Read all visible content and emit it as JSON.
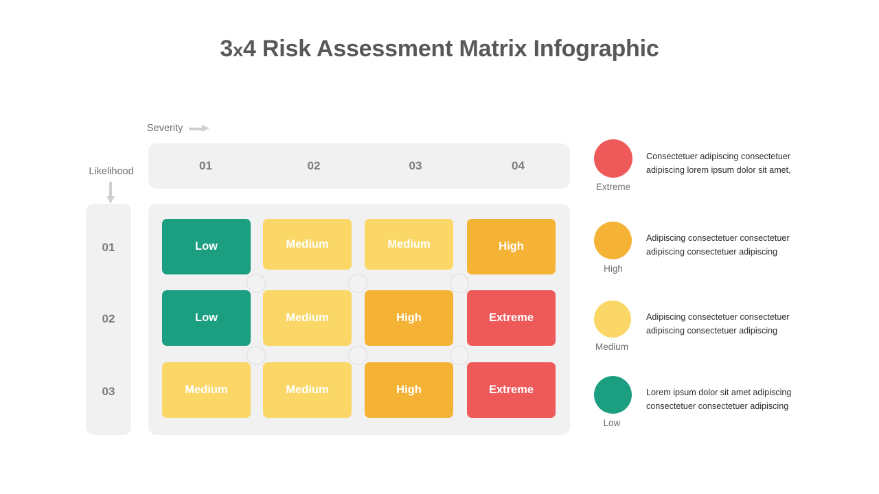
{
  "title": {
    "before": "3",
    "x": "x",
    "after": "4 Risk Assessment Matrix Infographic",
    "full": "3x4 Risk Assessment Matrix Infographic"
  },
  "axes": {
    "severity_label": "Severity",
    "severity_arrow": "arrow-right-icon",
    "likelihood_label": "Likelihood",
    "likelihood_arrow": "arrow-down-icon"
  },
  "colors": {
    "low": "#1C9E81",
    "medium": "#FAD766",
    "high": "#F5B336",
    "extreme": "#EE5A5A",
    "panel_bg": "#F1F1F1",
    "label_gray": "#7B7B7D",
    "title_gray": "#58585A",
    "node": "#F2F2F2"
  },
  "columns": [
    {
      "label": "01"
    },
    {
      "label": "02"
    },
    {
      "label": "03"
    },
    {
      "label": "04"
    }
  ],
  "rows": [
    {
      "label": "01"
    },
    {
      "label": "02"
    },
    {
      "label": "03"
    }
  ],
  "chart_data": {
    "type": "heatmap",
    "title": "3x4 Risk Assessment Matrix Infographic",
    "xlabel": "Severity",
    "ylabel": "Likelihood",
    "x_categories": [
      "01",
      "02",
      "03",
      "04"
    ],
    "y_categories": [
      "01",
      "02",
      "03"
    ],
    "levels": [
      {
        "name": "Low",
        "color": "#1C9E81",
        "value": 1
      },
      {
        "name": "Medium",
        "color": "#FAD766",
        "value": 2
      },
      {
        "name": "High",
        "color": "#F5B336",
        "value": 3
      },
      {
        "name": "Extreme",
        "color": "#EE5A5A",
        "value": 4
      }
    ],
    "cells": [
      [
        {
          "label": "Low",
          "level": "low",
          "value": 1
        },
        {
          "label": "Medium",
          "level": "medium",
          "value": 2
        },
        {
          "label": "Medium",
          "level": "medium",
          "value": 2
        },
        {
          "label": "High",
          "level": "high",
          "value": 3
        }
      ],
      [
        {
          "label": "Low",
          "level": "low",
          "value": 1
        },
        {
          "label": "Medium",
          "level": "medium",
          "value": 2
        },
        {
          "label": "High",
          "level": "high",
          "value": 3
        },
        {
          "label": "Extreme",
          "level": "extreme",
          "value": 4
        }
      ],
      [
        {
          "label": "Medium",
          "level": "medium",
          "value": 2
        },
        {
          "label": "Medium",
          "level": "medium",
          "value": 2
        },
        {
          "label": "High",
          "level": "high",
          "value": 3
        },
        {
          "label": "Extreme",
          "level": "extreme",
          "value": 4
        }
      ]
    ],
    "legend_position": "right",
    "grid": false
  },
  "legend": [
    {
      "name": "Extreme",
      "color": "#EE5A5A",
      "description": "Consectetuer adipiscing consectetuer adipiscing lorem ipsum dolor sit amet,"
    },
    {
      "name": "High",
      "color": "#F5B336",
      "description": "Adipiscing consectetuer consectetuer adipiscing consectetuer adipiscing"
    },
    {
      "name": "Medium",
      "color": "#FAD766",
      "description": "Adipiscing consectetuer consectetuer adipiscing consectetuer adipiscing"
    },
    {
      "name": "Low",
      "color": "#1C9E81",
      "description": "Lorem ipsum dolor sit amet adipiscing consectetuer consectetuer adipiscing"
    }
  ]
}
